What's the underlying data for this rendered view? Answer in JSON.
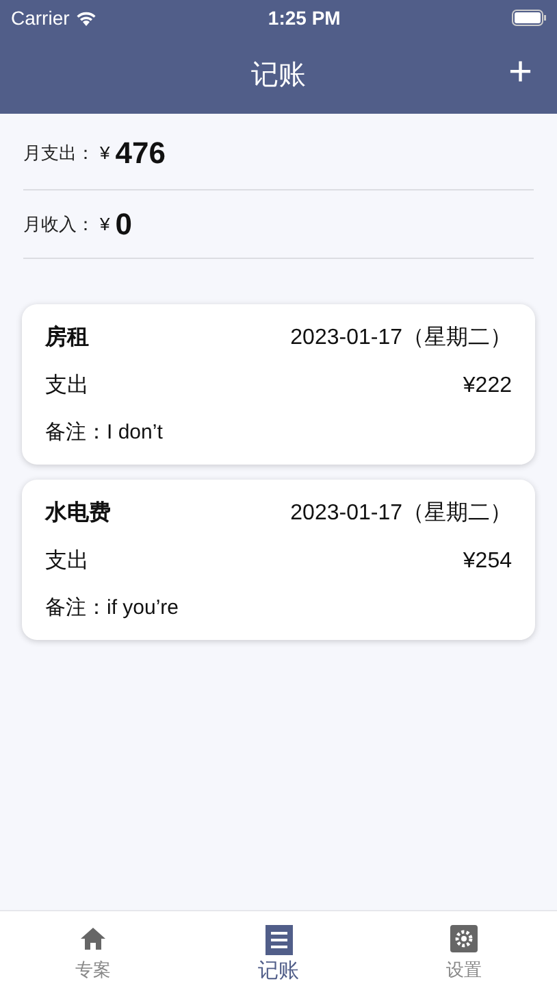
{
  "status_bar": {
    "carrier": "Carrier",
    "time": "1:25 PM"
  },
  "nav": {
    "title": "记账",
    "action": "+"
  },
  "summary": [
    {
      "label": "月支出：",
      "currency": "¥",
      "amount": "476"
    },
    {
      "label": "月收入：",
      "currency": "¥",
      "amount": "0"
    }
  ],
  "records": [
    {
      "title": "房租",
      "date": "2023-01-17（星期二）",
      "type": "支出",
      "amount": "¥222",
      "note": "备注：I don’t"
    },
    {
      "title": "水电费",
      "date": "2023-01-17（星期二）",
      "type": "支出",
      "amount": "¥254",
      "note": "备注：if you’re"
    }
  ],
  "tabs": [
    {
      "kind": "home",
      "label": "专案",
      "selected": false
    },
    {
      "kind": "ledger",
      "label": "记账",
      "selected": true
    },
    {
      "kind": "settings",
      "label": "设置",
      "selected": false
    }
  ]
}
